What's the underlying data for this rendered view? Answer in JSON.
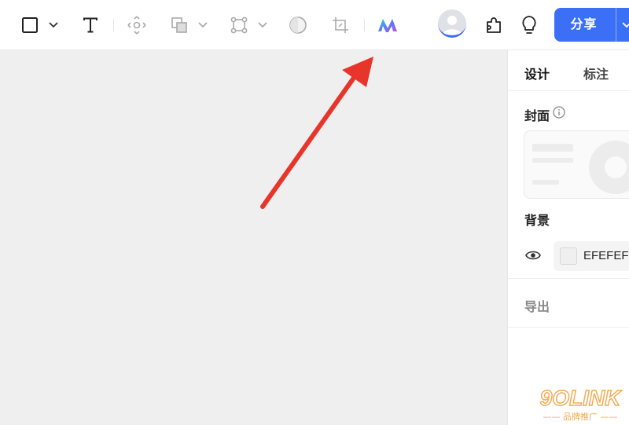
{
  "toolbar": {
    "icons": [
      "rectangle-icon",
      "chevron-down-icon",
      "text-icon",
      "move-icon",
      "boolean-shape-icon",
      "chevron-down-icon",
      "vector-points-icon",
      "chevron-down-icon",
      "ellipse-icon",
      "crop-icon",
      "ai-logo-icon",
      "avatar",
      "plugin-icon",
      "lightbulb-icon"
    ],
    "share_label": "分享"
  },
  "panel": {
    "tabs": [
      {
        "label": "设计",
        "active": true
      },
      {
        "label": "标注",
        "active": false
      }
    ],
    "cover_label": "封面",
    "background_label": "背景",
    "background_hex": "EFEFEF",
    "export_label": "导出"
  },
  "canvas": {
    "background": "#efefef",
    "annotation_color": "#e8352b"
  },
  "watermark": {
    "brand": "9OLINK",
    "tagline": "—— 品牌推广 ——"
  },
  "colors": {
    "accent": "#3b6ff6",
    "panel_bg": "#ffffff"
  }
}
